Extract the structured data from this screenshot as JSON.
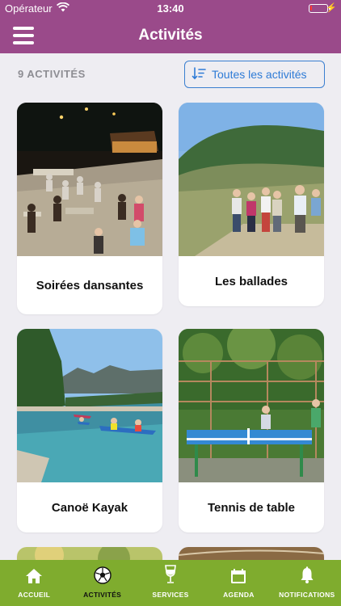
{
  "status_bar": {
    "carrier": "Opérateur",
    "time": "13:40",
    "battery_level": 0.12
  },
  "nav": {
    "title": "Activités"
  },
  "list": {
    "count_label": "9 ACTIVITÉS",
    "filter_label": "Toutes les activités"
  },
  "cards": [
    {
      "label": "Soirées dansantes"
    },
    {
      "label": "Les ballades"
    },
    {
      "label": "Canoë Kayak"
    },
    {
      "label": "Tennis de table"
    }
  ],
  "tabs": [
    {
      "label": "ACCUEIL",
      "icon": "home-icon"
    },
    {
      "label": "ACTIVITÉS",
      "icon": "soccer-ball-icon",
      "active": true
    },
    {
      "label": "SERVICES",
      "icon": "wine-glass-icon"
    },
    {
      "label": "AGENDA",
      "icon": "calendar-icon"
    },
    {
      "label": "NOTIFICATIONS",
      "icon": "bell-icon"
    }
  ],
  "colors": {
    "header": "#9a4a8a",
    "tabbar": "#7fac2e",
    "accent": "#2e7bd6"
  }
}
